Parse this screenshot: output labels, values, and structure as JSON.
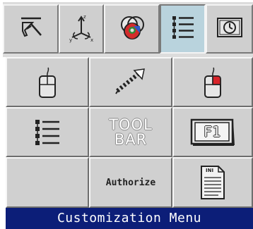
{
  "toolbar": {
    "buttons": [
      {
        "icon": "pointer-cursor-icon"
      },
      {
        "icon": "xyz-axes-icon"
      },
      {
        "icon": "color-palette-icon"
      },
      {
        "icon": "list-menu-icon",
        "active": true
      },
      {
        "icon": "clock-icon"
      }
    ]
  },
  "grid": {
    "tiles": [
      {
        "icon": "mouse-icon"
      },
      {
        "icon": "stretch-arrow-icon"
      },
      {
        "icon": "mouse-right-button-icon"
      },
      {
        "icon": "list-menu-icon"
      },
      {
        "icon": "toolbar-icon",
        "line1": "TOOL",
        "line2": "BAR"
      },
      {
        "icon": "f1-key-icon",
        "key_label": "F1"
      },
      {
        "icon": "blank"
      },
      {
        "label": "Authorize"
      },
      {
        "icon": "ini-file-icon",
        "file_label": "INI"
      }
    ]
  },
  "footer": {
    "title": "Customization Menu"
  },
  "colors": {
    "footer_bg": "#0c1e78",
    "active_tab_bg": "#b9d3dd",
    "tile_bg": "#d0d0d0",
    "mouse_red": "#d8242a"
  }
}
